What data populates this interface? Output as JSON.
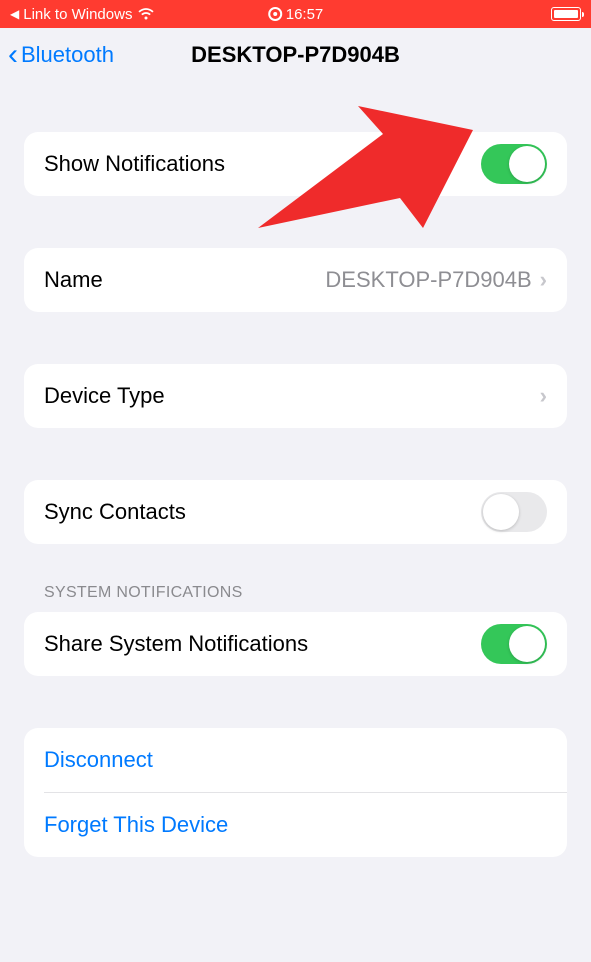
{
  "status_bar": {
    "app_back_label": "Link to Windows",
    "time": "16:57"
  },
  "nav": {
    "back_label": "Bluetooth",
    "title": "DESKTOP-P7D904B"
  },
  "rows": {
    "show_notifications": {
      "label": "Show Notifications"
    },
    "name": {
      "label": "Name",
      "value": "DESKTOP-P7D904B"
    },
    "device_type": {
      "label": "Device Type"
    },
    "sync_contacts": {
      "label": "Sync Contacts"
    },
    "share_system_notifications": {
      "label": "Share System Notifications"
    }
  },
  "sections": {
    "system_notifications": "SYSTEM NOTIFICATIONS"
  },
  "actions": {
    "disconnect": "Disconnect",
    "forget": "Forget This Device"
  }
}
